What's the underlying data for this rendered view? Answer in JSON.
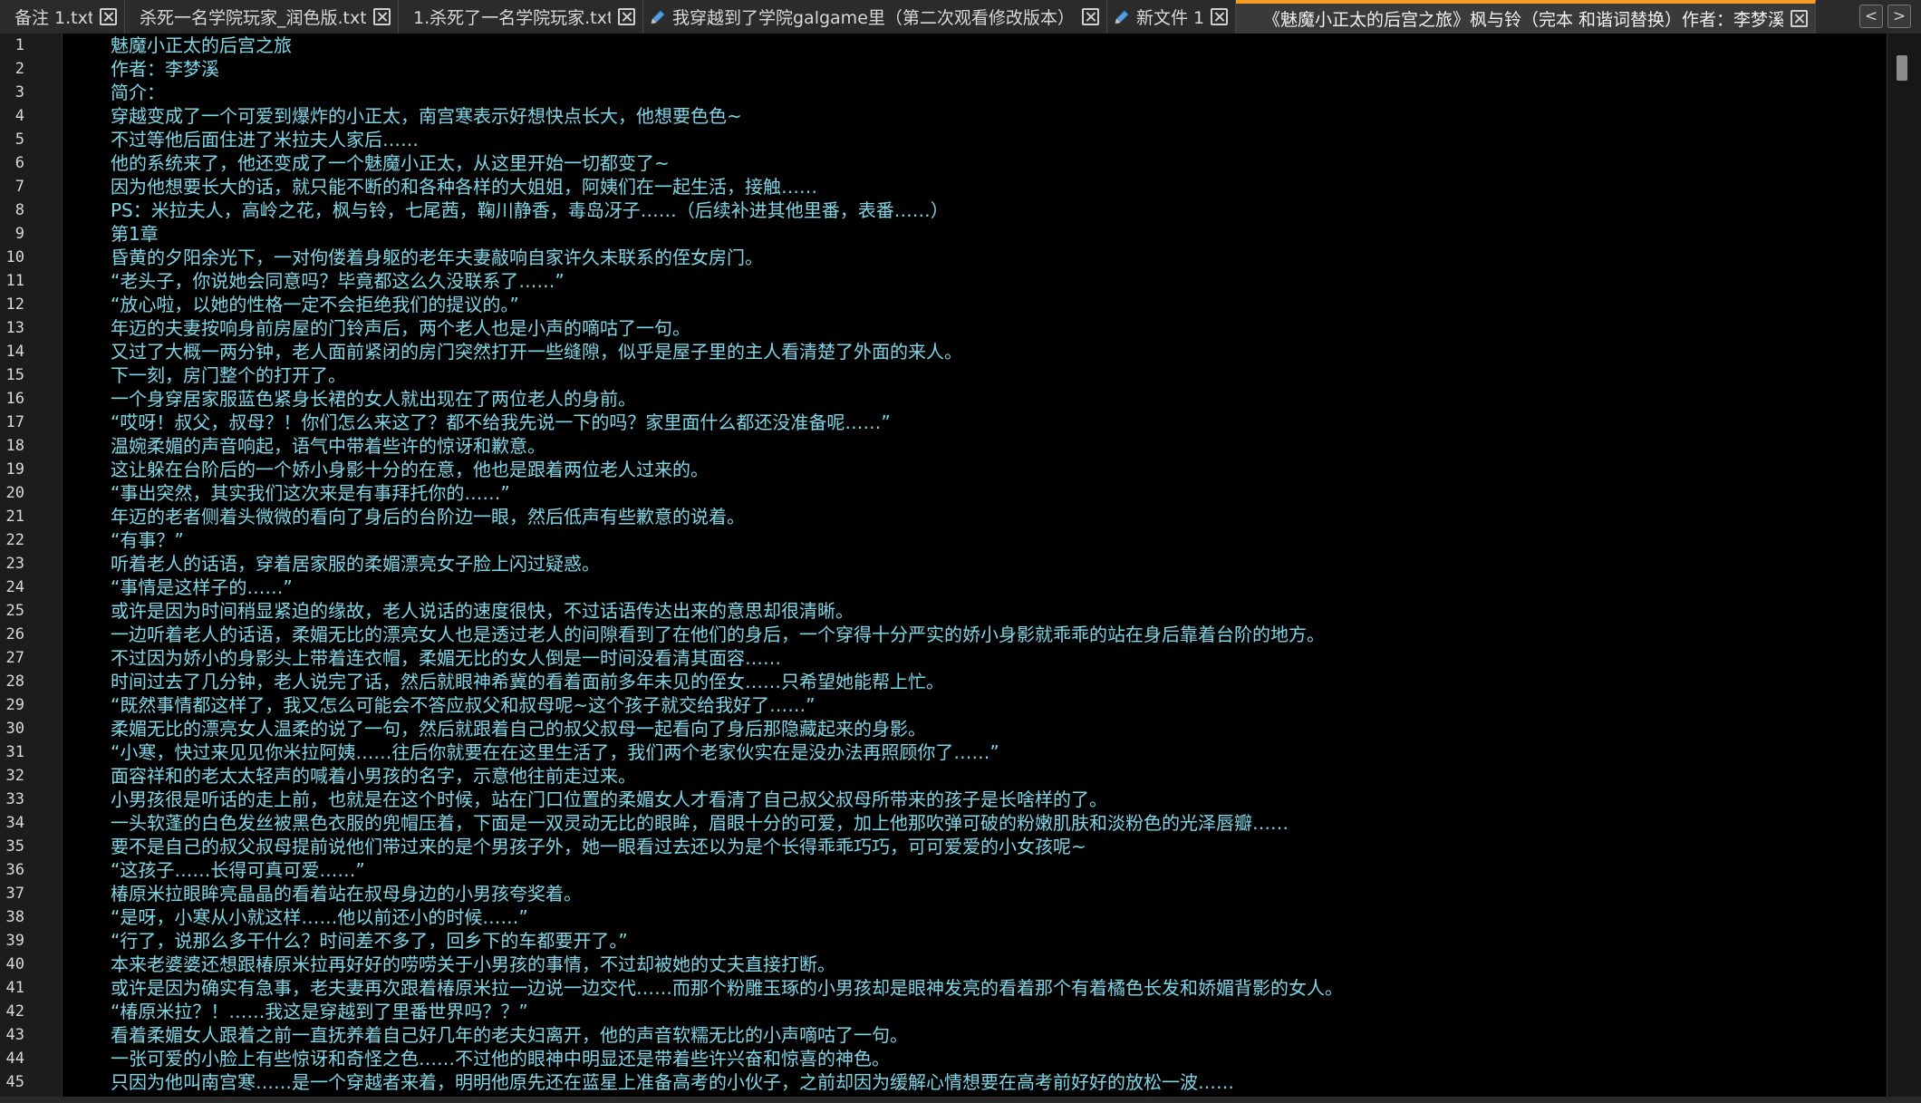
{
  "tabs": [
    {
      "label": "备注 1.txt",
      "modified": false,
      "active": false
    },
    {
      "label": "杀死一名学院玩家_润色版.txt",
      "modified": false,
      "active": false
    },
    {
      "label": "1.杀死了一名学院玩家.txt",
      "modified": false,
      "active": false
    },
    {
      "label": "我穿越到了学院galgame里（第二次观看修改版本）.txt",
      "modified": true,
      "active": false
    },
    {
      "label": "新文件 1",
      "modified": true,
      "active": false
    },
    {
      "label": "《魅魔小正太的后宫之旅》枫与铃（完本 和谐词替换）作者：李梦溪.txt",
      "modified": false,
      "active": true
    }
  ],
  "tab_nav": {
    "prev": "<",
    "next": ">"
  },
  "colors": {
    "text": "#7fd6e6",
    "line_number": "#d8d8d8",
    "active_tab_accent": "#f59a23"
  },
  "lines": [
    {
      "n": "1",
      "text": "魅魔小正太的后宫之旅"
    },
    {
      "n": "2",
      "text": "作者：李梦溪"
    },
    {
      "n": "3",
      "text": "简介："
    },
    {
      "n": "4",
      "text": "穿越变成了一个可爱到爆炸的小正太，南宫寒表示好想快点长大，他想要色色~"
    },
    {
      "n": "5",
      "text": "不过等他后面住进了米拉夫人家后……"
    },
    {
      "n": "6",
      "text": "他的系统来了，他还变成了一个魅魔小正太，从这里开始一切都变了~"
    },
    {
      "n": "7",
      "text": "因为他想要长大的话，就只能不断的和各种各样的大姐姐，阿姨们在一起生活，接触……"
    },
    {
      "n": "8",
      "text": "PS：米拉夫人，高岭之花，枫与铃，七尾茜，鞠川静香，毒岛冴子……（后续补进其他里番，表番……）"
    },
    {
      "n": "9",
      "text": "第1章"
    },
    {
      "n": "10",
      "text": "昏黄的夕阳余光下，一对佝偻着身躯的老年夫妻敲响自家许久未联系的侄女房门。"
    },
    {
      "n": "11",
      "text": "“老头子，你说她会同意吗？毕竟都这么久没联系了……”"
    },
    {
      "n": "12",
      "text": "“放心啦，以她的性格一定不会拒绝我们的提议的。”"
    },
    {
      "n": "13",
      "text": "年迈的夫妻按响身前房屋的门铃声后，两个老人也是小声的嘀咕了一句。"
    },
    {
      "n": "14",
      "text": "又过了大概一两分钟，老人面前紧闭的房门突然打开一些缝隙，似乎是屋子里的主人看清楚了外面的来人。"
    },
    {
      "n": "15",
      "text": "下一刻，房门整个的打开了。"
    },
    {
      "n": "16",
      "text": "一个身穿居家服蓝色紧身长裙的女人就出现在了两位老人的身前。"
    },
    {
      "n": "17",
      "text": "“哎呀！叔父，叔母？！你们怎么来这了？都不给我先说一下的吗？家里面什么都还没准备呢……”"
    },
    {
      "n": "18",
      "text": "温婉柔媚的声音响起，语气中带着些许的惊讶和歉意。"
    },
    {
      "n": "19",
      "text": "这让躲在台阶后的一个娇小身影十分的在意，他也是跟着两位老人过来的。"
    },
    {
      "n": "20",
      "text": "“事出突然，其实我们这次来是有事拜托你的……”"
    },
    {
      "n": "21",
      "text": "年迈的老者侧着头微微的看向了身后的台阶边一眼，然后低声有些歉意的说着。"
    },
    {
      "n": "22",
      "text": "“有事？”"
    },
    {
      "n": "23",
      "text": "听着老人的话语，穿着居家服的柔媚漂亮女子脸上闪过疑惑。"
    },
    {
      "n": "24",
      "text": "“事情是这样子的……”"
    },
    {
      "n": "25",
      "text": "或许是因为时间稍显紧迫的缘故，老人说话的速度很快，不过话语传达出来的意思却很清晰。"
    },
    {
      "n": "26",
      "text": "一边听着老人的话语，柔媚无比的漂亮女人也是透过老人的间隙看到了在他们的身后，一个穿得十分严实的娇小身影就乖乖的站在身后靠着台阶的地方。"
    },
    {
      "n": "27",
      "text": "不过因为娇小的身影头上带着连衣帽，柔媚无比的女人倒是一时间没看清其面容……"
    },
    {
      "n": "28",
      "text": "时间过去了几分钟，老人说完了话，然后就眼神希冀的看着面前多年未见的侄女……只希望她能帮上忙。"
    },
    {
      "n": "29",
      "text": "“既然事情都这样了，我又怎么可能会不答应叔父和叔母呢~这个孩子就交给我好了……”"
    },
    {
      "n": "30",
      "text": "柔媚无比的漂亮女人温柔的说了一句，然后就跟着自己的叔父叔母一起看向了身后那隐藏起来的身影。"
    },
    {
      "n": "31",
      "text": "“小寒，快过来见见你米拉阿姨……往后你就要在在这里生活了，我们两个老家伙实在是没办法再照顾你了……”"
    },
    {
      "n": "32",
      "text": "面容祥和的老太太轻声的喊着小男孩的名字，示意他往前走过来。"
    },
    {
      "n": "33",
      "text": "小男孩很是听话的走上前，也就是在这个时候，站在门口位置的柔媚女人才看清了自己叔父叔母所带来的孩子是长啥样的了。"
    },
    {
      "n": "34",
      "text": "一头软蓬的白色发丝被黑色衣服的兜帽压着，下面是一双灵动无比的眼眸，眉眼十分的可爱，加上他那吹弹可破的粉嫩肌肤和淡粉色的光泽唇瓣……"
    },
    {
      "n": "35",
      "text": "要不是自己的叔父叔母提前说他们带过来的是个男孩子外，她一眼看过去还以为是个长得乖乖巧巧，可可爱爱的小女孩呢~"
    },
    {
      "n": "36",
      "text": "“这孩子……长得可真可爱……”"
    },
    {
      "n": "37",
      "text": "椿原米拉眼眸亮晶晶的看着站在叔母身边的小男孩夸奖着。"
    },
    {
      "n": "38",
      "text": "“是呀，小寒从小就这样……他以前还小的时候……”"
    },
    {
      "n": "39",
      "text": "“行了，说那么多干什么？时间差不多了，回乡下的车都要开了。”"
    },
    {
      "n": "40",
      "text": "本来老婆婆还想跟椿原米拉再好好的唠唠关于小男孩的事情，不过却被她的丈夫直接打断。"
    },
    {
      "n": "41",
      "text": "或许是因为确实有急事，老夫妻再次跟着椿原米拉一边说一边交代……而那个粉雕玉琢的小男孩却是眼神发亮的看着那个有着橘色长发和娇媚背影的女人。"
    },
    {
      "n": "42",
      "text": "“椿原米拉？！……我这是穿越到了里番世界吗？？”"
    },
    {
      "n": "43",
      "text": "看着柔媚女人跟着之前一直抚养着自己好几年的老夫妇离开，他的声音软糯无比的小声嘀咕了一句。"
    },
    {
      "n": "44",
      "text": "一张可爱的小脸上有些惊讶和奇怪之色……不过他的眼神中明显还是带着些许兴奋和惊喜的神色。"
    },
    {
      "n": "45",
      "text": "只因为他叫南宫寒……是一个穿越者来着，明明他原先还在蓝星上准备高考的小伙子，之前却因为缓解心情想要在高考前好好的放松一波……"
    }
  ]
}
